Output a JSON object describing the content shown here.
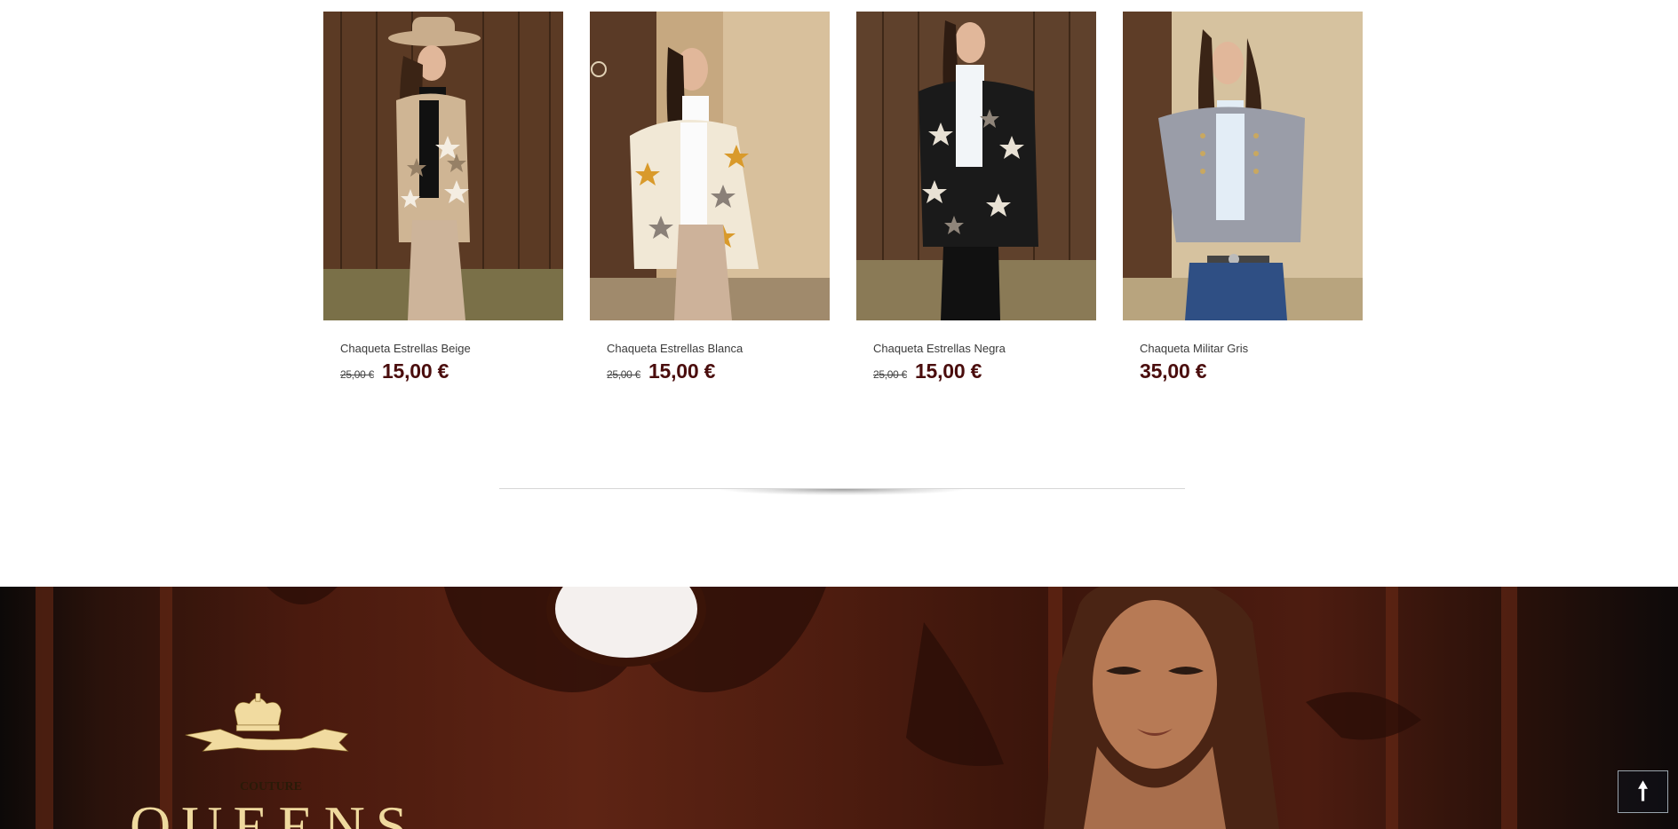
{
  "products": [
    {
      "name": "Chaqueta Estrellas Beige",
      "old_price": "25,00 €",
      "price": "15,00 €",
      "image": "model-beige-star-cardigan"
    },
    {
      "name": "Chaqueta Estrellas Blanca",
      "old_price": "25,00 €",
      "price": "15,00 €",
      "image": "model-white-star-cardigan"
    },
    {
      "name": "Chaqueta Estrellas Negra",
      "old_price": "25,00 €",
      "price": "15,00 €",
      "image": "model-black-star-cardigan"
    },
    {
      "name": "Chaqueta Militar Gris",
      "old_price": "",
      "price": "35,00 €",
      "image": "model-grey-military-jacket"
    }
  ],
  "banner": {
    "logo_sub": "COUTURE",
    "logo_word": "QUEENS"
  },
  "scroll_top": {
    "icon": "arrow-up-icon",
    "glyph": "🠕"
  },
  "colors": {
    "price": "#4a0d0d",
    "banner": "#4a1a0e",
    "logo_gold": "#efd99e"
  }
}
